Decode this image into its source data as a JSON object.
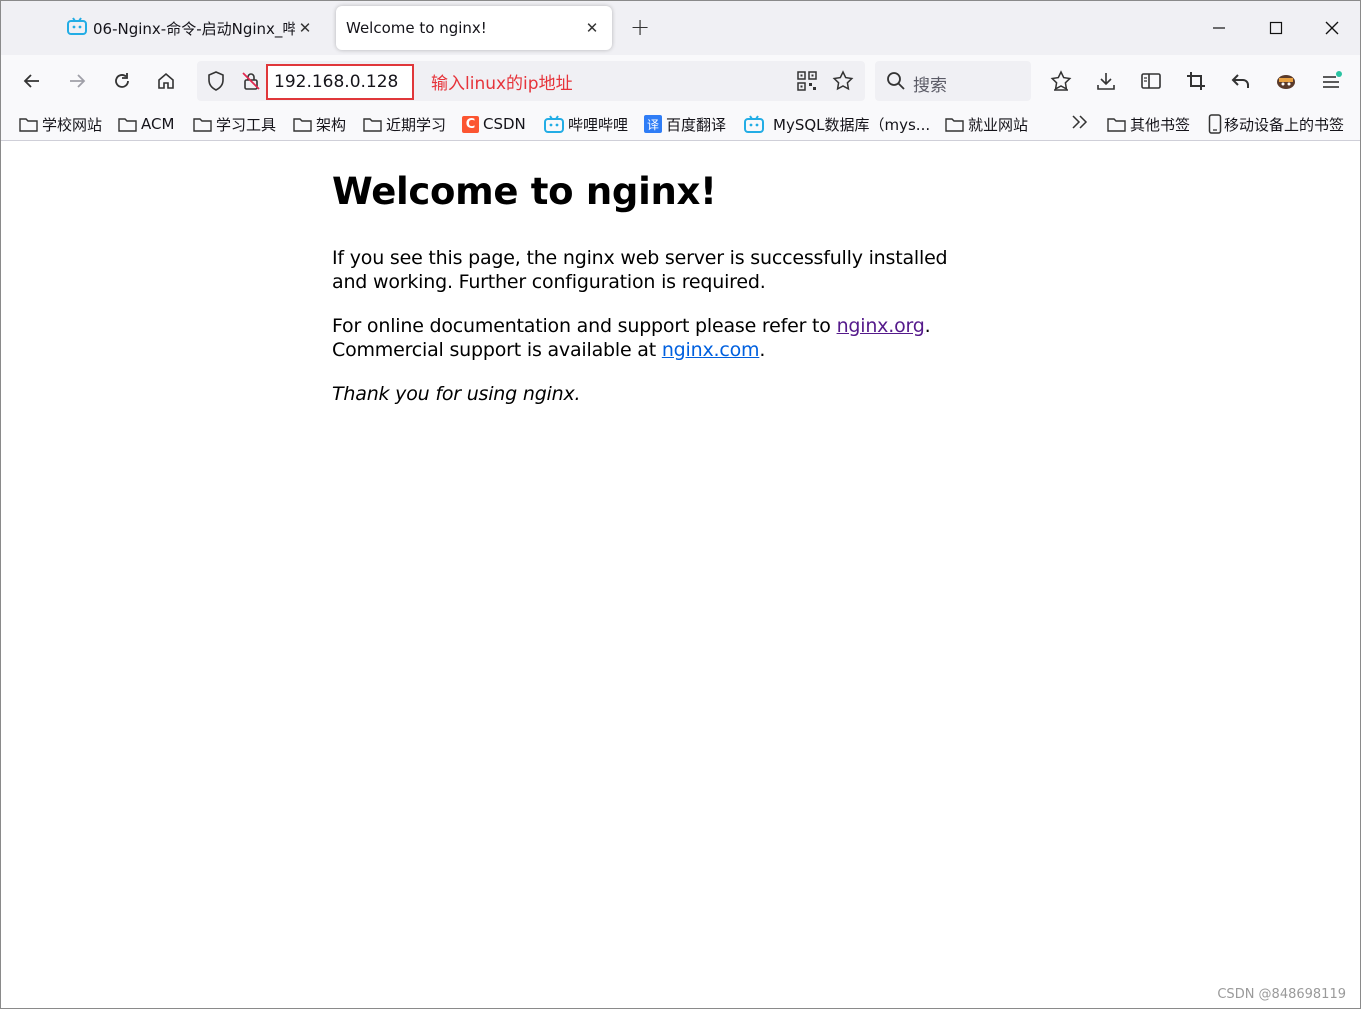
{
  "tabs": [
    {
      "title": "06-Nginx-命令-启动Nginx_哔哩",
      "close": "✕",
      "active": false
    },
    {
      "title": "Welcome to nginx!",
      "close": "✕",
      "active": true
    }
  ],
  "new_tab_label": "+",
  "address": {
    "url": "192.168.0.128",
    "annotation": "输入linux的ip地址"
  },
  "search": {
    "placeholder": "搜索"
  },
  "bookmarks": [
    {
      "label": "学校网站",
      "icon": "folder-icon"
    },
    {
      "label": "ACM",
      "icon": "folder-icon"
    },
    {
      "label": "学习工具",
      "icon": "folder-icon"
    },
    {
      "label": "架构",
      "icon": "folder-icon"
    },
    {
      "label": "近期学习",
      "icon": "folder-icon"
    },
    {
      "label": "CSDN",
      "icon": "csdn-icon",
      "badge": "C"
    },
    {
      "label": "哔哩哔哩",
      "icon": "bilibili-icon"
    },
    {
      "label": "百度翻译",
      "icon": "translate-icon",
      "badge": "译"
    },
    {
      "label": "MySQL数据库（mys...",
      "icon": "bilibili-icon"
    },
    {
      "label": "就业网站",
      "icon": "folder-icon"
    },
    {
      "label": "其他书签",
      "icon": "folder-icon"
    },
    {
      "label": "移动设备上的书签",
      "icon": "mobile-icon"
    }
  ],
  "page": {
    "heading": "Welcome to nginx!",
    "p1": "If you see this page, the nginx web server is successfully installed and working. Further configuration is required.",
    "p2_before": "For online documentation and support please refer to ",
    "p2_link": "nginx.org",
    "p2_after": ".",
    "p3_before": "Commercial support is available at ",
    "p3_link": "nginx.com",
    "p3_after": ".",
    "thanks": "Thank you for using nginx."
  },
  "watermark": "CSDN @848698119",
  "colors": {
    "annotation": "#e6333a",
    "visited_link": "#551a8b",
    "link": "#0060df",
    "bilibili": "#23ade5"
  }
}
